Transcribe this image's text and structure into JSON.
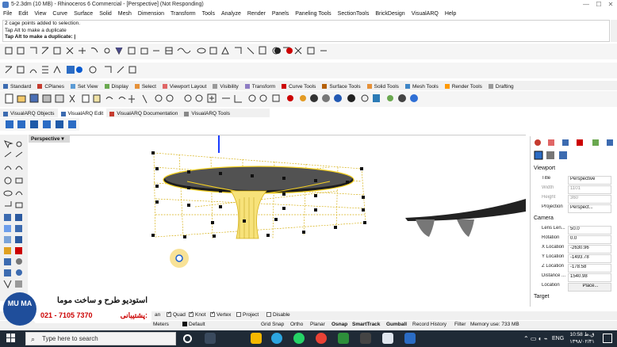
{
  "window": {
    "title": "5-2.3dm (10 MB) - Rhinoceros 6 Commercial - [Perspective] (Not Responding)",
    "minimize": "—",
    "maximize": "☐",
    "close": "✕"
  },
  "menu": [
    "File",
    "Edit",
    "View",
    "Curve",
    "Surface",
    "Solid",
    "Mesh",
    "Dimension",
    "Transform",
    "Tools",
    "Analyze",
    "Render",
    "Panels",
    "Paneling Tools",
    "SectionTools",
    "BrickDesign",
    "VisualARQ",
    "Help"
  ],
  "command": {
    "history": [
      "2 cage points added to selection.",
      "Tap Alt to make a duplicate"
    ],
    "prompt": "Tap Alt to make a duplicate:"
  },
  "toolbar_tabs": [
    "Standard",
    "CPlanes",
    "Set View",
    "Display",
    "Select",
    "Viewport Layout",
    "Visibility",
    "Transform",
    "Curve Tools",
    "Surface Tools",
    "Solid Tools",
    "Mesh Tools",
    "Render Tools",
    "Drafting"
  ],
  "toolbar_tab_colors": [
    "#3c6bb0",
    "#c53b2f",
    "#5b9bd5",
    "#6aa84f",
    "#e69138",
    "#e06666",
    "#999999",
    "#8e7cc3",
    "#cc0000",
    "#b45f06",
    "#e69138",
    "#3d85c6",
    "#ff9900",
    "#999999"
  ],
  "visualarq_tabs": [
    "VisualARQ Objects",
    "VisualARQ Edit",
    "VisualARQ Documentation",
    "VisualARQ Tools"
  ],
  "viewport": {
    "name": "Perspective",
    "dropdown": "▾"
  },
  "properties": {
    "section_viewport": "Viewport",
    "rows_viewport": [
      {
        "k": "Title",
        "v": "Perspective",
        "disabled": false
      },
      {
        "k": "Width",
        "v": "1101",
        "disabled": true
      },
      {
        "k": "Height",
        "v": "360",
        "disabled": true
      },
      {
        "k": "Projection",
        "v": "Perspect...",
        "disabled": false
      }
    ],
    "section_camera": "Camera",
    "rows_camera": [
      {
        "k": "Lens Len...",
        "v": "50.0"
      },
      {
        "k": "Rotation",
        "v": "0.0"
      },
      {
        "k": "X Location",
        "v": "-2630.96"
      },
      {
        "k": "Y Location",
        "v": "-1493.78"
      },
      {
        "k": "Z Location",
        "v": "-178.58"
      },
      {
        "k": "Distance ...",
        "v": "1540.98"
      },
      {
        "k": "Location",
        "v": "Place..."
      }
    ],
    "section_target": "Target"
  },
  "osnap": [
    "an",
    "Quad",
    "Knot",
    "Vertex",
    "Project",
    "Disable"
  ],
  "statusbar": {
    "units": "Meters",
    "layer": "Default",
    "items": [
      "Grid Snap",
      "Ortho",
      "Planar",
      "Osnap",
      "SmartTrack",
      "Gumball",
      "Record History",
      "Filter"
    ],
    "bold_items": [
      "Osnap",
      "SmartTrack",
      "Gumball"
    ],
    "memory": "Memory use: 733 MB"
  },
  "watermark": {
    "logo_text": "MU MA",
    "studio": "استودیو طرح و ساخت موما",
    "support_label": "پشتیبانی:",
    "phone": "021 - 7105 7370"
  },
  "taskbar": {
    "search_placeholder": "Type here to search",
    "lang": "ENG",
    "time": "10:58 ق.ظ",
    "date": "۱۳۹۸/۰۲/۳۱"
  }
}
